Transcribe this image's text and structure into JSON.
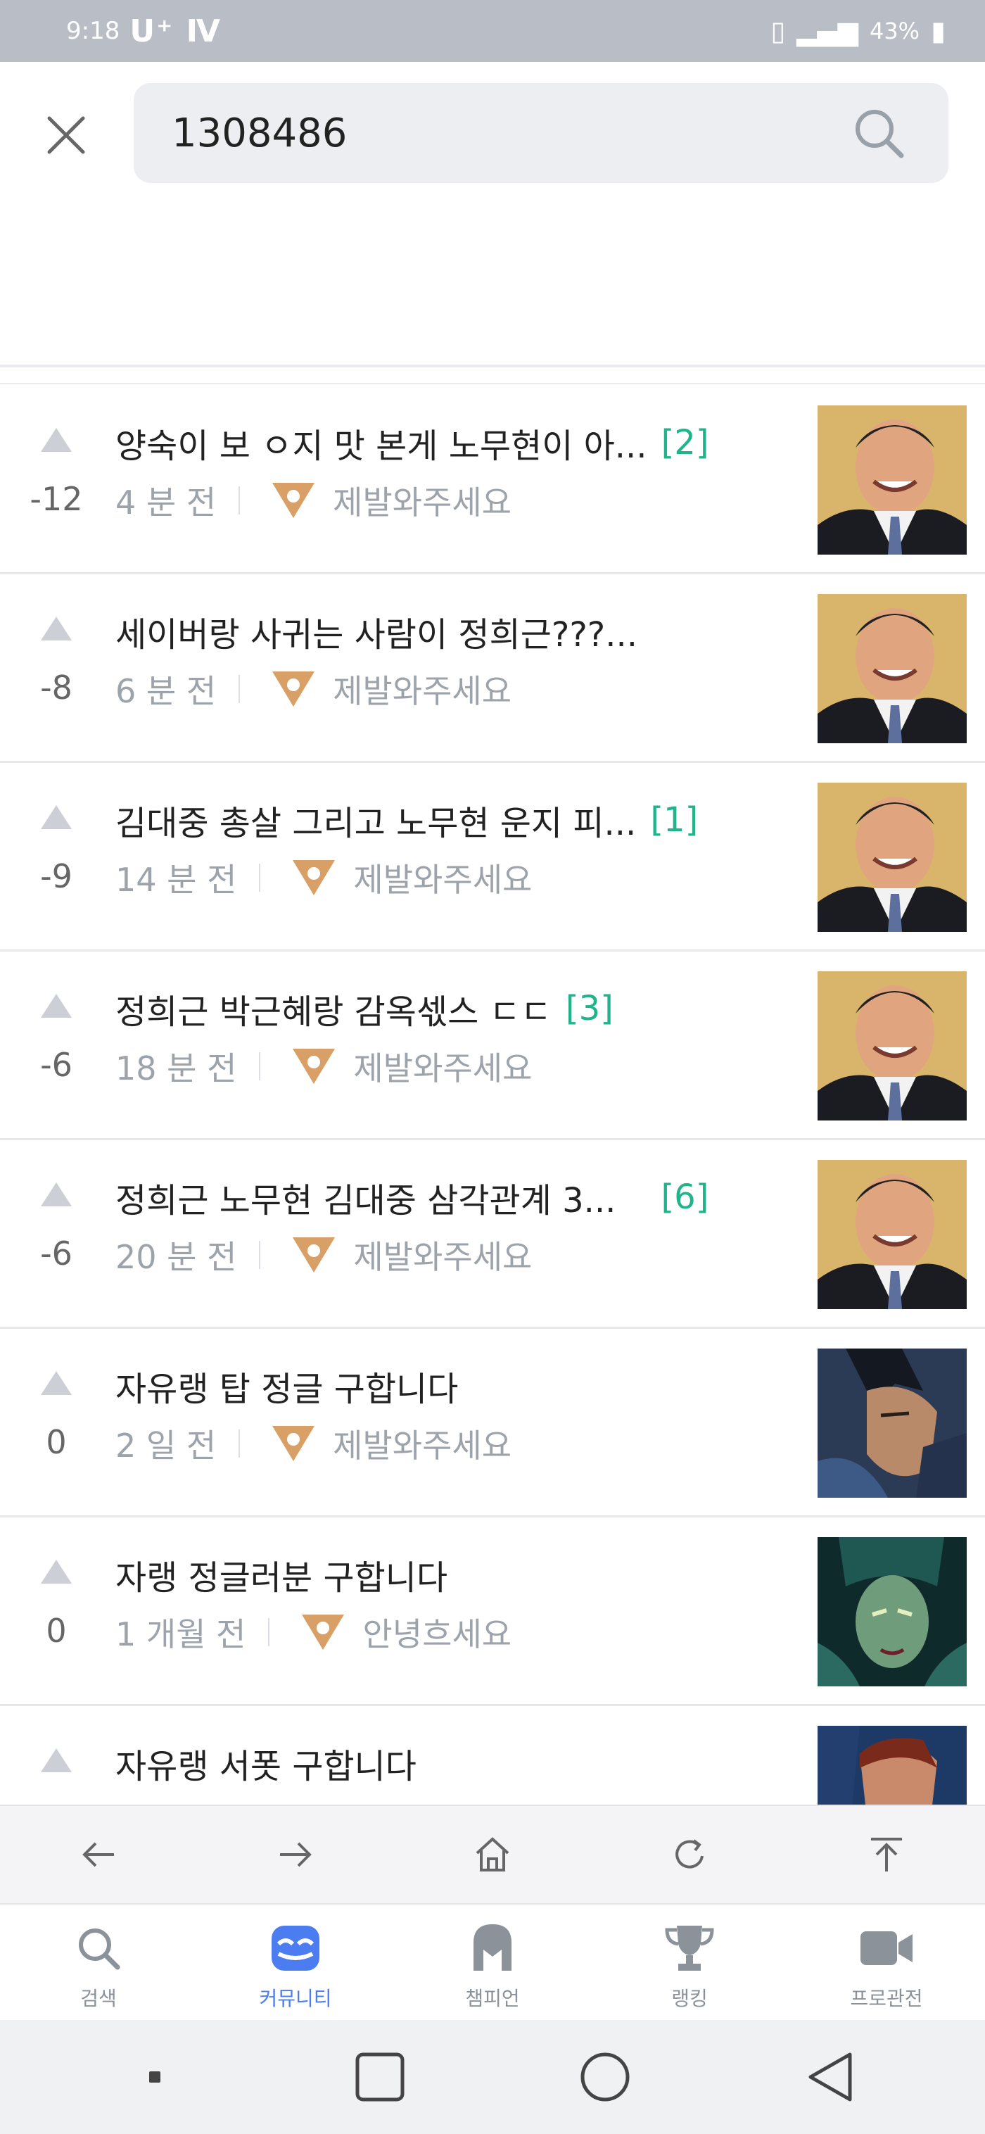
{
  "status_bar": {
    "time": "9:18",
    "carrier": "U⁺ Ⅳ",
    "battery": "43%"
  },
  "search": {
    "value": "1308486"
  },
  "posts": [
    {
      "votes": "-12",
      "title": "양숙이 보 ㅇ지 맛 본게 노무현이 아...",
      "comments": "[2]",
      "time": "4 분 전",
      "author": "제발와주세요",
      "thumb": "roh-photo"
    },
    {
      "votes": "-8",
      "title": "세이버랑 사귀는 사람이 정희근???...",
      "comments": "",
      "time": "6 분 전",
      "author": "제발와주세요",
      "thumb": "roh-photo"
    },
    {
      "votes": "-9",
      "title": "김대중 총살 그리고 노무현 운지 피...",
      "comments": "[1]",
      "time": "14 분 전",
      "author": "제발와주세요",
      "thumb": "roh-photo"
    },
    {
      "votes": "-6",
      "title": "정희근 박근혜랑 감옥섻스 ㄷㄷ",
      "comments": "[3]",
      "time": "18 분 전",
      "author": "제발와주세요",
      "thumb": "roh-photo"
    },
    {
      "votes": "-6",
      "title": "정희근 노무현 김대중 삼각관계 3...",
      "comments": "[6]",
      "time": "20 분 전",
      "author": "제발와주세요",
      "thumb": "roh-photo"
    },
    {
      "votes": "0",
      "title": "자유랭 탑 정글 구합니다",
      "comments": "",
      "time": "2 일 전",
      "author": "제발와주세요",
      "thumb": "yasuo-icon"
    },
    {
      "votes": "0",
      "title": "자랭 정글러분 구합니다",
      "comments": "",
      "time": "1 개월 전",
      "author": "안녕흐세요",
      "thumb": "cassiopeia-icon"
    },
    {
      "votes": "",
      "title": "자유랭 서폿 구합니다",
      "comments": "",
      "time": "",
      "author": "",
      "thumb": "champion-icon"
    }
  ],
  "browser_toolbar": [
    "back-arrow",
    "forward-arrow",
    "home",
    "refresh",
    "scroll-top"
  ],
  "tabs": [
    {
      "label": "검색",
      "icon": "search-icon",
      "active": false
    },
    {
      "label": "커뮤니티",
      "icon": "community-icon",
      "active": true
    },
    {
      "label": "챔피언",
      "icon": "helmet-icon",
      "active": false
    },
    {
      "label": "랭킹",
      "icon": "trophy-icon",
      "active": false
    },
    {
      "label": "프로관전",
      "icon": "video-camera-icon",
      "active": false
    }
  ],
  "colors": {
    "accent": "#4b7cf0",
    "comment_count": "#1fb48c",
    "tier_badge": "#d8a066",
    "status_bar": "#b9bec6"
  }
}
